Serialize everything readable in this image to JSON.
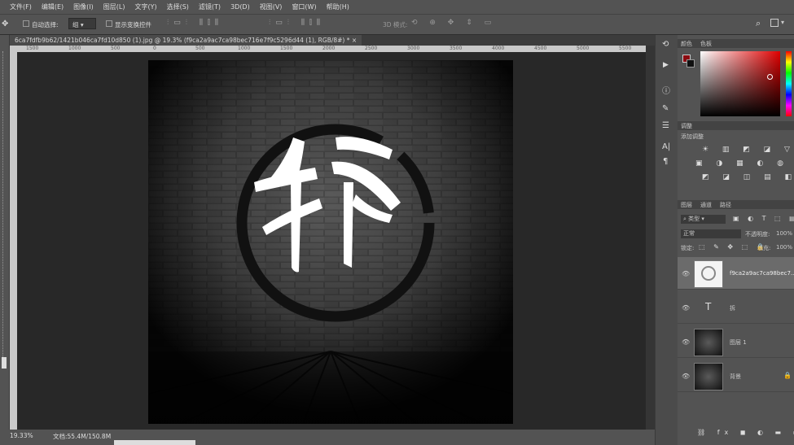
{
  "menu": [
    "文件(F)",
    "编辑(E)",
    "图像(I)",
    "图层(L)",
    "文字(Y)",
    "选择(S)",
    "滤镜(T)",
    "3D(D)",
    "视图(V)",
    "窗口(W)",
    "帮助(H)"
  ],
  "options": {
    "auto_select_label": "自动选择:",
    "auto_select_value": "组",
    "show_transform_label": "显示变换控件",
    "mode_3d_label": "3D 模式:"
  },
  "document": {
    "tab_title": "6ca7fdfb9b62/1421b046ca7fd10d850 (1).jpg @ 19.3% (f9ca2a9ac7ca98bec716e7f9c5296d44 (1), RGB/8#) *"
  },
  "ruler_ticks": [
    "1500",
    "1000",
    "500",
    "0",
    "500",
    "1000",
    "1500",
    "2000",
    "2500",
    "3000",
    "3500",
    "4000",
    "4500",
    "5000",
    "5500"
  ],
  "artwork": {
    "calligraphy_char": "拆"
  },
  "status": {
    "zoom": "19.33%",
    "doc_info": "文档:55.4M/150.8M"
  },
  "panels": {
    "color_tabs": [
      "颜色",
      "色板"
    ],
    "adjust_tab": "调整",
    "adjust_add_label": "添加调整",
    "layer_tabs": [
      "图层",
      "通道",
      "路径"
    ],
    "kind_label": "类型",
    "blend_mode": "正常",
    "opacity_label": "不透明度:",
    "opacity_value": "100%",
    "lock_label": "锁定:",
    "fill_label": "填充:",
    "fill_value": "100%",
    "layers": [
      {
        "name": "f9ca2a9ac7ca98bec7..."
      },
      {
        "name": "拆"
      },
      {
        "name": "图层 1"
      },
      {
        "name": "背景"
      }
    ]
  },
  "colors": {
    "foreground": "#8b0a10",
    "background": "#111111",
    "picker_hue": "#e00000"
  }
}
